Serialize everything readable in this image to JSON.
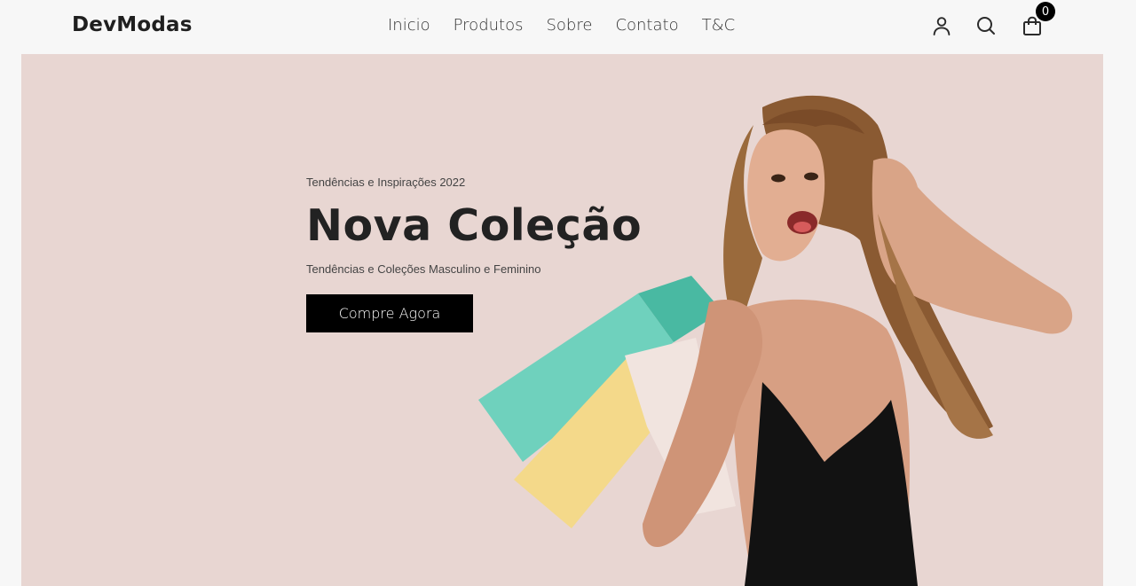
{
  "brand": "DevModas",
  "nav": {
    "items": [
      {
        "label": "Inicio"
      },
      {
        "label": "Produtos"
      },
      {
        "label": "Sobre"
      },
      {
        "label": "Contato"
      },
      {
        "label": "T&C"
      }
    ],
    "icons": [
      "user-icon",
      "search-icon",
      "shopping-bag-icon"
    ],
    "cart_count": "0"
  },
  "hero": {
    "eyebrow": "Tendências e Inspirações 2022",
    "title": "Nova Coleção",
    "subtitle": "Tendências e Coleções Masculino e Feminino",
    "button": "Compre Agora",
    "background": "#e8d6d2"
  }
}
